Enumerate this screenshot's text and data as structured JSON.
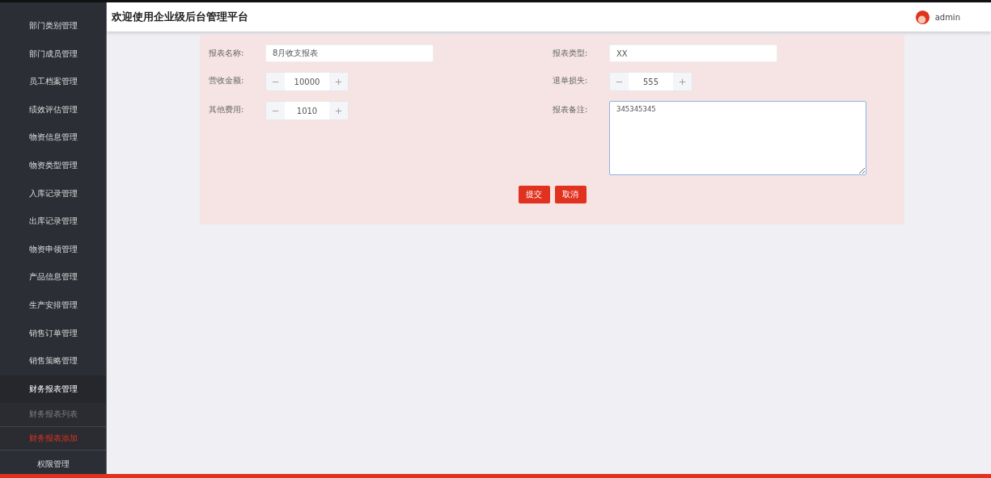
{
  "header": {
    "title": "欢迎使用企业级后台管理平台",
    "user": "admin"
  },
  "sidebar": {
    "items": [
      {
        "label": "部门类别管理",
        "selected": false
      },
      {
        "label": "部门成员管理",
        "selected": false
      },
      {
        "label": "员工档案管理",
        "selected": false
      },
      {
        "label": "绩效评估管理",
        "selected": false
      },
      {
        "label": "物资信息管理",
        "selected": false
      },
      {
        "label": "物资类型管理",
        "selected": false
      },
      {
        "label": "入库记录管理",
        "selected": false
      },
      {
        "label": "出库记录管理",
        "selected": false
      },
      {
        "label": "物资申领管理",
        "selected": false
      },
      {
        "label": "产品信息管理",
        "selected": false
      },
      {
        "label": "生产安排管理",
        "selected": false
      },
      {
        "label": "销售订单管理",
        "selected": false
      },
      {
        "label": "销售策略管理",
        "selected": false
      },
      {
        "label": "财务报表管理",
        "selected": false,
        "expanded": true,
        "children": [
          {
            "label": "财务报表列表",
            "selected": false
          },
          {
            "label": "财务报表添加",
            "selected": true
          }
        ]
      },
      {
        "label": "权限管理",
        "selected": false
      }
    ]
  },
  "form": {
    "fields": [
      {
        "label": "报表名称:",
        "kind": "text",
        "value": "8月收支报表"
      },
      {
        "label": "报表类型:",
        "kind": "text",
        "value": "XX"
      },
      {
        "label": "营收金额:",
        "kind": "stepper",
        "value": "10000"
      },
      {
        "label": "退单损失:",
        "kind": "stepper",
        "value": "555"
      },
      {
        "label": "其他费用:",
        "kind": "stepper",
        "value": "1010"
      },
      {
        "label": "报表备注:",
        "kind": "textarea",
        "value": "345345345",
        "focused": true
      }
    ],
    "buttons": [
      "提交",
      "取消"
    ]
  }
}
